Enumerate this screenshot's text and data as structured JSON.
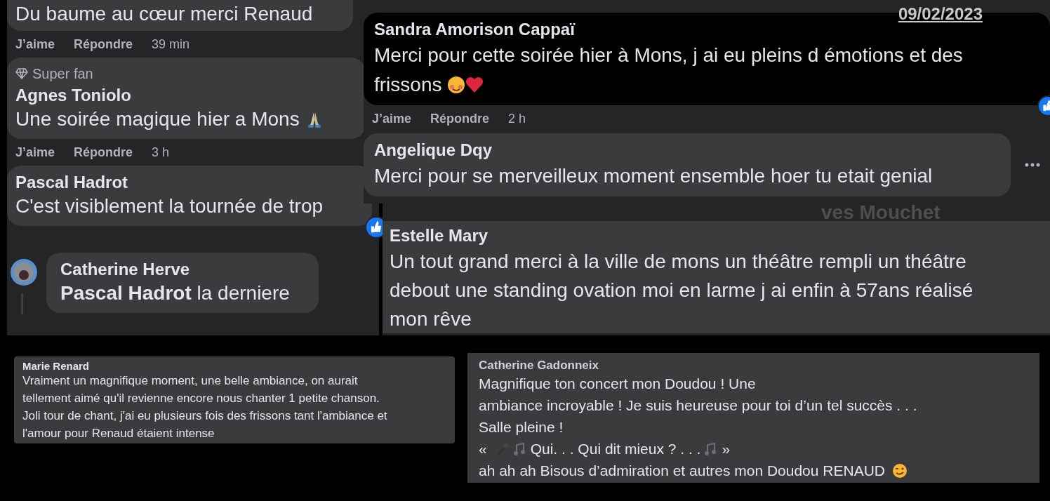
{
  "date_stamp": "09/02/2023",
  "left_thread": [
    {
      "kind": "comment",
      "text": "Du baume au cœur merci Renaud",
      "footer": {
        "like": "J’aime",
        "reply": "Répondre",
        "time": "39 min"
      }
    },
    {
      "kind": "comment",
      "badge": "Super fan",
      "author": "Agnes Toniolo",
      "text": "Une soirée magique hier a Mons",
      "emoji": true,
      "footer": {
        "like": "J’aime",
        "reply": "Répondre",
        "time": "3 h"
      }
    },
    {
      "kind": "comment",
      "author": "Pascal Hadrot",
      "text": "C'est visiblement la tournée de trop",
      "reaction": true
    },
    {
      "kind": "reply",
      "author": "Catherine Herve",
      "text": "**Pascal Hadrot** la derniere"
    }
  ],
  "right_thread": [
    {
      "kind": "highlighted",
      "author": "Sandra Amorison Cappaï",
      "lines": [
        "Merci pour cette soirée hier à Mons, j ai eu pleins d émotions et des",
        "frissons"
      ],
      "emoji": true,
      "reaction": true,
      "footer": {
        "like": "J’aime",
        "reply": "Répondre",
        "time": "2 h"
      }
    },
    {
      "kind": "comment",
      "author": "Angelique Dqy",
      "text": "Merci pour se merveilleux moment ensemble hoer tu etait genial",
      "menu": true
    }
  ],
  "partial_name": "ves Mouchet",
  "estelle": {
    "author": "Estelle Mary",
    "lines": [
      "Un tout grand merci à la ville de mons un théâtre rempli un théâtre",
      "debout une standing ovation moi en larme j ai enfin à 57ans réalisé",
      "mon rêve"
    ]
  },
  "marie": {
    "author": "Marie Renard",
    "lines": [
      "Vraiment un magnifique moment, une belle ambiance, on aurait",
      "tellement aimé qu'il revienne encore nous chanter 1 petite chanson.",
      "Joli tour de chant, j'ai eu plusieurs fois des frissons tant l'ambiance et",
      "l'amour pour Renaud étaient intense"
    ]
  },
  "gadonneix": {
    "author": "Catherine Gadonneix",
    "lines": [
      {
        "kind": "plain",
        "text": "Magnifique ton concert mon Doudou ! Une"
      },
      {
        "kind": "plain",
        "text": "ambiance incroyable ! Je suis heureuse pour toi d’un tel succès . . ."
      },
      {
        "kind": "plain",
        "text": "Salle pleine !"
      },
      {
        "kind": "quoted",
        "open": "«",
        "text": "Qui. . . Qui dit mieux ? . . .",
        "close": "»"
      },
      {
        "kind": "ending",
        "text": "ah ah ah Bisous d’admiration et autres mon Doudou RENAUD"
      }
    ]
  }
}
